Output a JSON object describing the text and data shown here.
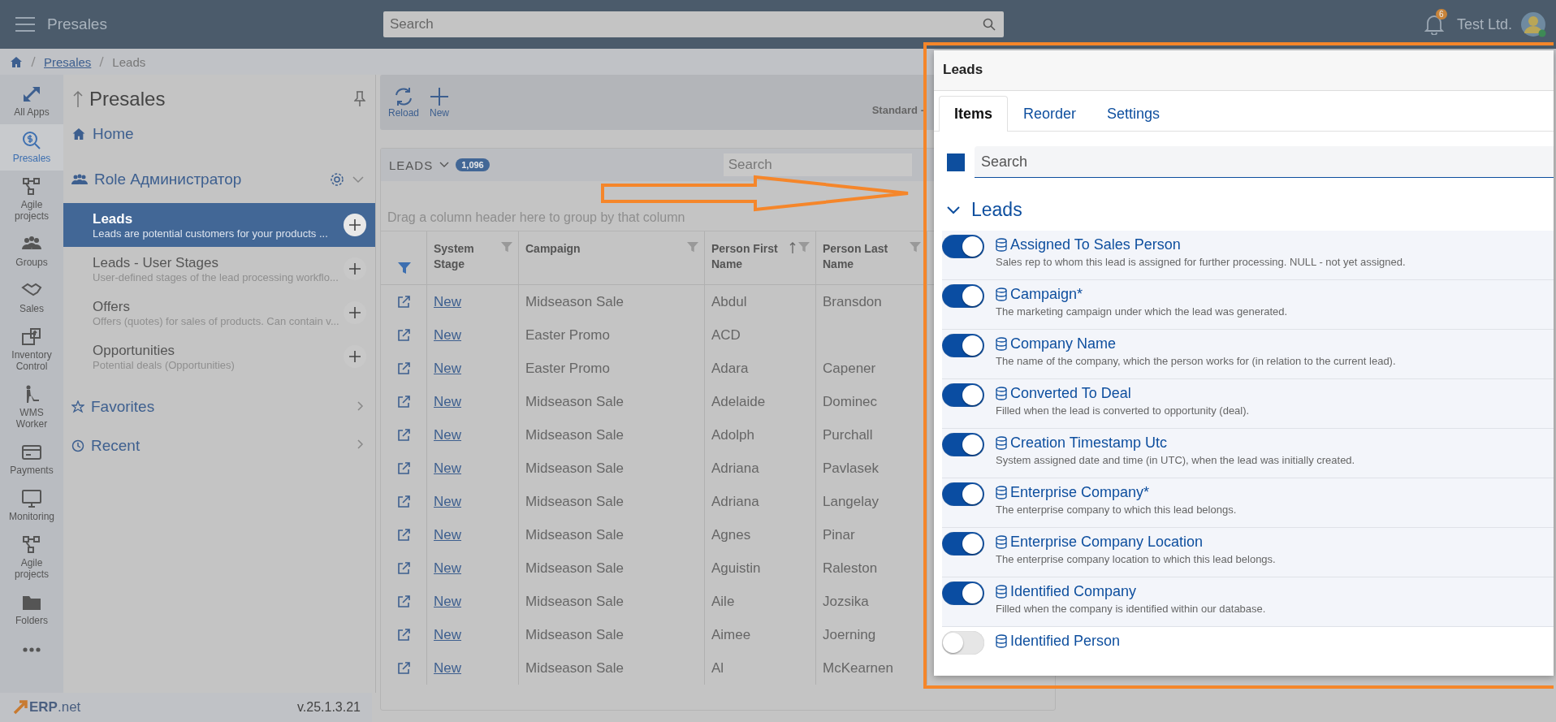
{
  "topbar": {
    "app_title": "Presales",
    "search_placeholder": "Search",
    "notification_count": "6",
    "company": "Test Ltd."
  },
  "breadcrumb": [
    "Presales",
    "Leads"
  ],
  "rail": [
    {
      "label": "All Apps",
      "selected": false
    },
    {
      "label": "Presales",
      "selected": true
    },
    {
      "label": "Agile projects",
      "selected": false
    },
    {
      "label": "Groups",
      "selected": false
    },
    {
      "label": "Sales",
      "selected": false
    },
    {
      "label": "Inventory Control",
      "selected": false
    },
    {
      "label": "WMS Worker",
      "selected": false
    },
    {
      "label": "Payments",
      "selected": false
    },
    {
      "label": "Monitoring",
      "selected": false
    },
    {
      "label": "Agile projects",
      "selected": false
    },
    {
      "label": "Folders",
      "selected": false
    }
  ],
  "nav": {
    "title": "Presales",
    "home": "Home",
    "role": "Role Администратор",
    "items": [
      {
        "title": "Leads",
        "description": "Leads are potential customers for your products ...",
        "selected": true
      },
      {
        "title": "Leads - User Stages",
        "description": "User-defined stages of the lead processing workflo...",
        "selected": false
      },
      {
        "title": "Offers",
        "description": "Offers (quotes) for sales of products. Can contain v...",
        "selected": false
      },
      {
        "title": "Opportunities",
        "description": "Potential deals (Opportunities)",
        "selected": false
      }
    ],
    "favorites": "Favorites",
    "recent": "Recent"
  },
  "footer": {
    "logo": "**ERP**.net",
    "version": "v.25.1.3.21"
  },
  "toolbar": {
    "buttons": [
      "Reload",
      "New"
    ],
    "view": "Standard -"
  },
  "grid": {
    "title": "LEADS",
    "count": "1,096",
    "search_placeholder": "Search",
    "group_hint": "Drag a column header here to group by that column",
    "columns": [
      {
        "label": "System Stage",
        "sorted": false
      },
      {
        "label": "Campaign",
        "sorted": false
      },
      {
        "label": "Person First Name",
        "sorted": true
      },
      {
        "label": "Person Last Name",
        "sorted": false
      }
    ],
    "rows": [
      [
        "New",
        "Midseason Sale",
        "Abdul",
        "Bransdon"
      ],
      [
        "New",
        "Easter Promo",
        "ACD",
        ""
      ],
      [
        "New",
        "Easter Promo",
        "Adara",
        "Capener"
      ],
      [
        "New",
        "Midseason Sale",
        "Adelaide",
        "Dominec"
      ],
      [
        "New",
        "Midseason Sale",
        "Adolph",
        "Purchall"
      ],
      [
        "New",
        "Midseason Sale",
        "Adriana",
        "Pavlasek"
      ],
      [
        "New",
        "Midseason Sale",
        "Adriana",
        "Langelay"
      ],
      [
        "New",
        "Midseason Sale",
        "Agnes",
        "Pinar"
      ],
      [
        "New",
        "Midseason Sale",
        "Aguistin",
        "Raleston"
      ],
      [
        "New",
        "Midseason Sale",
        "Aile",
        "Jozsika"
      ],
      [
        "New",
        "Midseason Sale",
        "Aimee",
        "Joerning"
      ],
      [
        "New",
        "Midseason Sale",
        "Al",
        "McKearnen"
      ]
    ]
  },
  "panel": {
    "title": "Leads",
    "tabs": [
      {
        "label": "Items",
        "selected": true
      },
      {
        "label": "Reorder",
        "selected": false
      },
      {
        "label": "Settings",
        "selected": false
      }
    ],
    "select_all": {
      "checked": true
    },
    "search_placeholder": "Search",
    "group": {
      "title": "Leads",
      "expanded": true
    },
    "items": [
      {
        "name": "Assigned To Sales Person",
        "description": "Sales rep to whom this lead is assigned for further processing. NULL - not yet assigned.",
        "on": true
      },
      {
        "name": "Campaign*",
        "description": "The marketing campaign under which the lead was generated.",
        "on": true
      },
      {
        "name": "Company Name",
        "description": "The name of the company, which the person works for (in relation to the current lead).",
        "on": true
      },
      {
        "name": "Converted To Deal",
        "description": "Filled when the lead is converted to opportunity (deal).",
        "on": true
      },
      {
        "name": "Creation Timestamp Utc",
        "description": "System assigned date and time (in UTC), when the lead was initially created.",
        "on": true
      },
      {
        "name": "Enterprise Company*",
        "description": "The enterprise company to which this lead belongs.",
        "on": true
      },
      {
        "name": "Enterprise Company Location",
        "description": "The enterprise company location to which this lead belongs.",
        "on": true
      },
      {
        "name": "Identified Company",
        "description": "Filled when the company is identified within our database.",
        "on": true
      },
      {
        "name": "Identified Person",
        "on": false
      }
    ]
  }
}
